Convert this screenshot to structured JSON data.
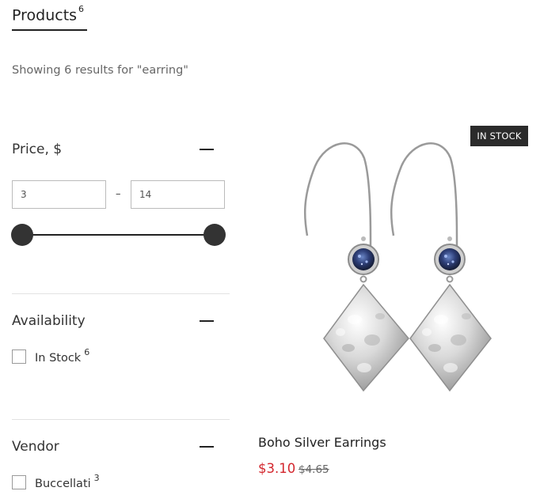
{
  "products_tab": {
    "title": "Products",
    "count": "6"
  },
  "results_text": "Showing 6 results for \"earring\"",
  "price_filter": {
    "title": "Price, $",
    "min_value": "3",
    "max_value": "14",
    "range_separator": "–",
    "slider_min_fraction": 0,
    "slider_max_fraction": 1
  },
  "availability_filter": {
    "title": "Availability",
    "options": [
      {
        "label": "In Stock",
        "count": "6"
      }
    ]
  },
  "vendor_filter": {
    "title": "Vendor",
    "options": [
      {
        "label": "Buccellati",
        "count": "3"
      }
    ]
  },
  "product": {
    "badge": "IN STOCK",
    "name": "Boho Silver Earrings",
    "sale_price": "$3.10",
    "original_price": "$4.65"
  },
  "colors": {
    "sale": "#d3262d",
    "badge_bg": "#2b2b2b"
  }
}
